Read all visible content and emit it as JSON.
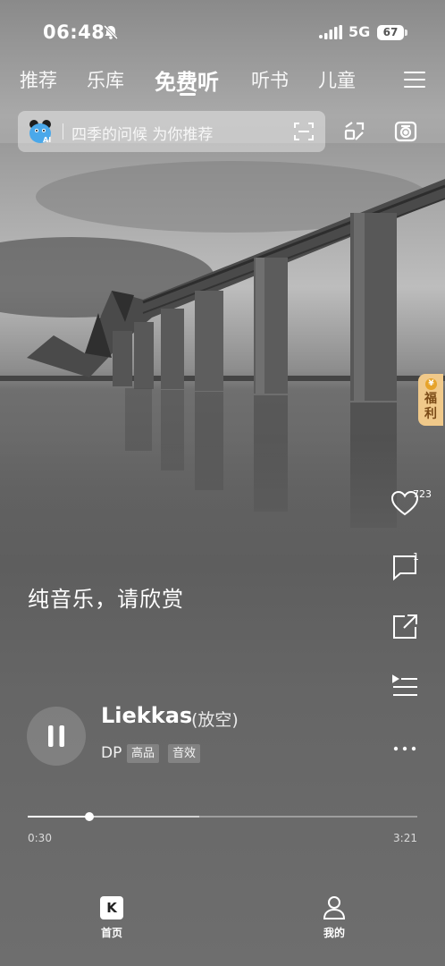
{
  "status_bar": {
    "time": "06:48",
    "network": "5G",
    "battery": "67"
  },
  "top_nav": {
    "tabs": [
      {
        "label": "推荐"
      },
      {
        "label": "乐库"
      },
      {
        "label": "免费听"
      },
      {
        "label": "听书"
      },
      {
        "label": "儿童"
      }
    ],
    "active_tab": "免费听"
  },
  "search": {
    "placeholder": "四季的问候 为你推荐",
    "ai_badge": "AI"
  },
  "welfare_badge": {
    "label": "福利",
    "coin": "¥"
  },
  "actions": {
    "like_count": "723",
    "comment_count": "1"
  },
  "player": {
    "lyric": "纯音乐，请欣赏",
    "song_title": "Liekkas",
    "song_subtitle": "(放空)",
    "artist": "DP",
    "tags": [
      "高品",
      "音效"
    ],
    "current_time": "0:30",
    "total_time": "3:21",
    "progress": 0.158,
    "buffered": 0.44
  },
  "bottom_nav": {
    "items": [
      {
        "label": "首页",
        "icon_text": "K"
      },
      {
        "label": "我的"
      }
    ]
  },
  "icons": {
    "status": [
      "mute-icon",
      "signal-icon"
    ],
    "top": [
      "menu-icon",
      "scan-icon",
      "recognize-icon",
      "radio-icon"
    ],
    "actions": [
      "heart-icon",
      "comment-icon",
      "share-icon",
      "playlist-icon",
      "more-icon"
    ],
    "player": [
      "pause-icon"
    ]
  },
  "colors": {
    "welfare": "#f0c98a",
    "ai_blue": "#4aa8ea"
  }
}
